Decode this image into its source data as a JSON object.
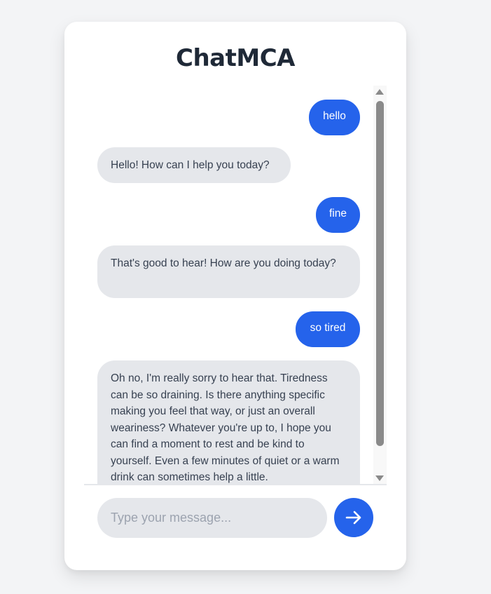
{
  "app": {
    "title": "ChatMCA"
  },
  "messages": [
    {
      "role": "user",
      "text": "hello"
    },
    {
      "role": "bot",
      "text": "Hello! How can I help you today?"
    },
    {
      "role": "user",
      "text": "fine"
    },
    {
      "role": "bot",
      "text": "That's good to hear! How are you doing today?"
    },
    {
      "role": "user",
      "text": "so tired"
    },
    {
      "role": "bot",
      "text": "Oh no, I'm really sorry to hear that. Tiredness can be so draining. Is there anything specific making you feel that way, or just an overall weariness? Whatever you're up to, I hope you can find a moment to rest and be kind to yourself. Even a few minutes of quiet or a warm drink can sometimes help a little."
    }
  ],
  "composer": {
    "placeholder": "Type your message...",
    "value": "",
    "send_icon": "arrow-right-icon"
  },
  "colors": {
    "accent": "#2563eb",
    "bot_bubble": "#e5e7eb",
    "background": "#f3f4f6"
  }
}
